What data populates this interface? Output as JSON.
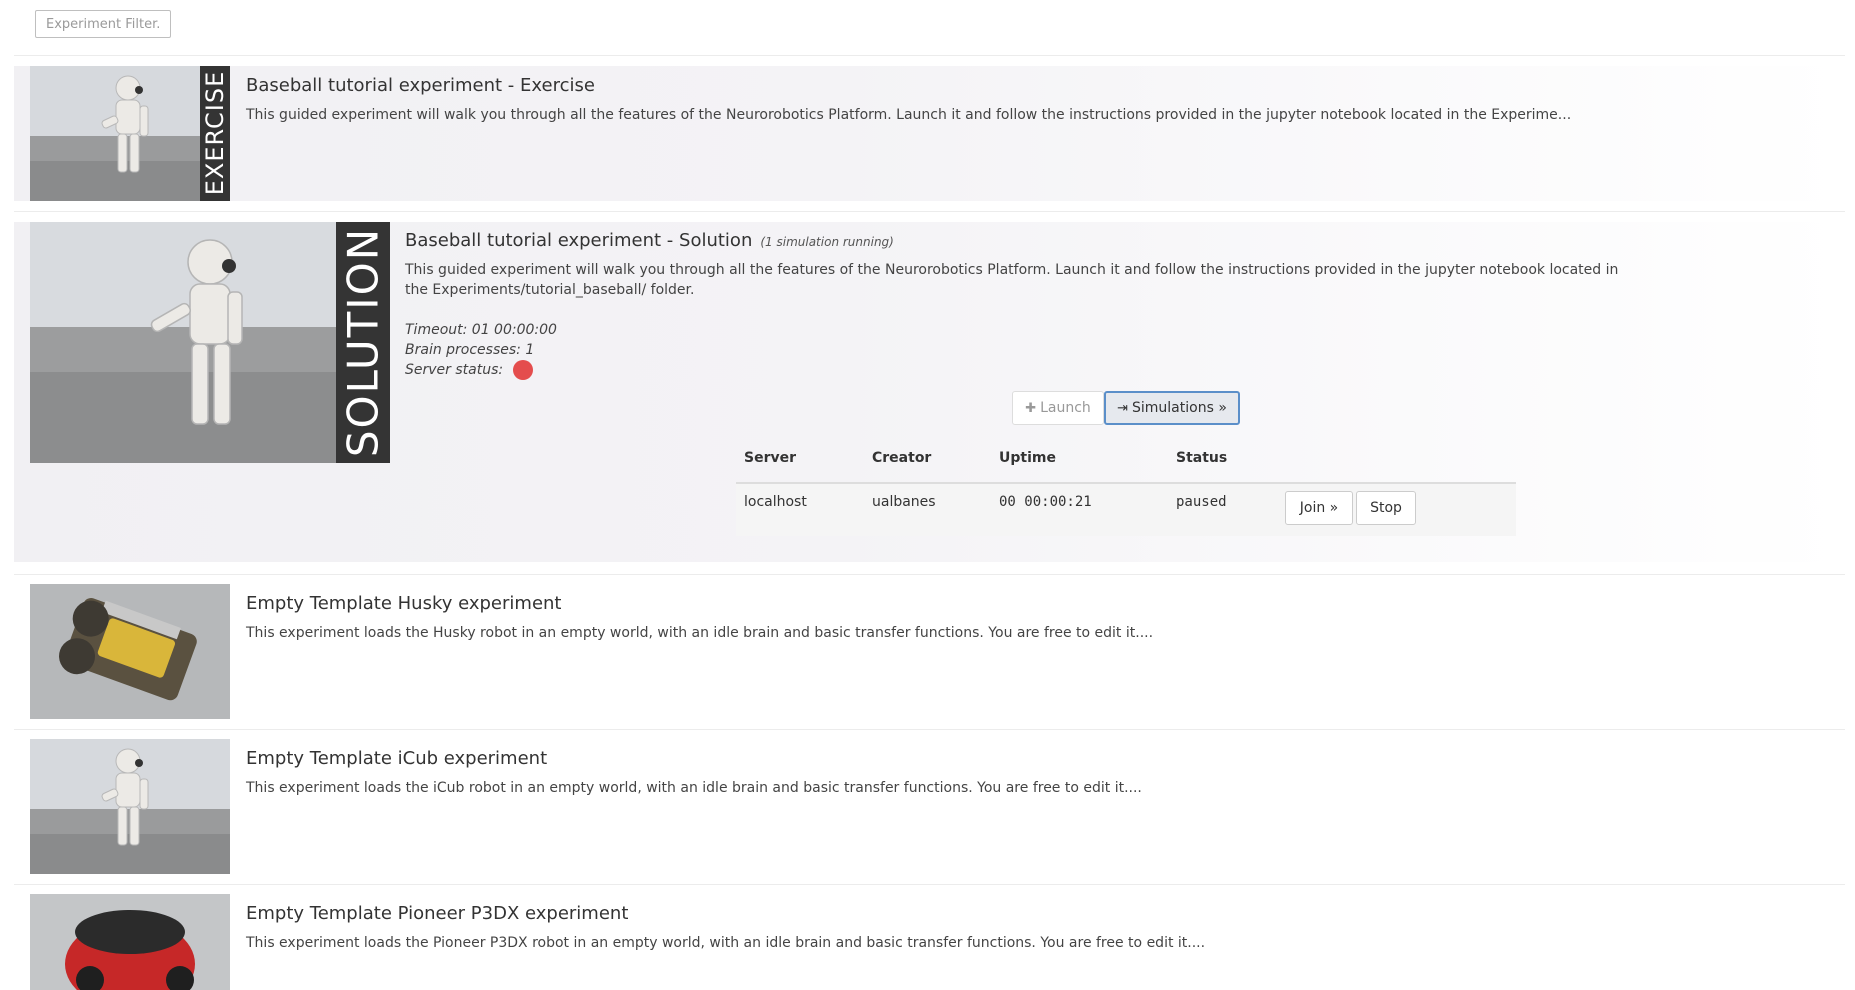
{
  "filter": {
    "placeholder": "Experiment Filter..."
  },
  "experiments": [
    {
      "banner": "EXERCISE",
      "title": "Baseball tutorial experiment - Exercise",
      "description": "This guided experiment will walk you through all the features of the Neurorobotics Platform. Launch it and follow the instructions provided in the jupyter notebook located in the Experime..."
    },
    {
      "banner": "SOLUTION",
      "title": "Baseball tutorial experiment - Solution",
      "running": "(1 simulation running)",
      "description": "This guided experiment will walk you through all the features of the Neurorobotics Platform. Launch it and follow the instructions provided in the jupyter notebook located in the Experiments/tutorial_baseball/ folder.",
      "timeout": "Timeout: 01 00:00:00",
      "brain_processes": "Brain processes: 1",
      "server_status_label": "Server status:",
      "server_status_color": "#e44d4d",
      "launch_label": "Launch",
      "simulations_label": "Simulations »",
      "table": {
        "headers": [
          "Server",
          "Creator",
          "Uptime",
          "Status"
        ],
        "rows": [
          {
            "server": "localhost",
            "creator": "ualbanes",
            "uptime": "00 00:00:21",
            "status": "paused",
            "join_label": "Join »",
            "stop_label": "Stop"
          }
        ]
      }
    },
    {
      "title": "Empty Template Husky experiment",
      "description": "This experiment loads the Husky robot in an empty world, with an idle brain and basic transfer functions. You are free to edit it...."
    },
    {
      "title": "Empty Template iCub experiment",
      "description": "This experiment loads the iCub robot in an empty world, with an idle brain and basic transfer functions. You are free to edit it...."
    },
    {
      "title": "Empty Template Pioneer P3DX experiment",
      "description": "This experiment loads the Pioneer P3DX robot in an empty world, with an idle brain and basic transfer functions. You are free to edit it...."
    }
  ]
}
